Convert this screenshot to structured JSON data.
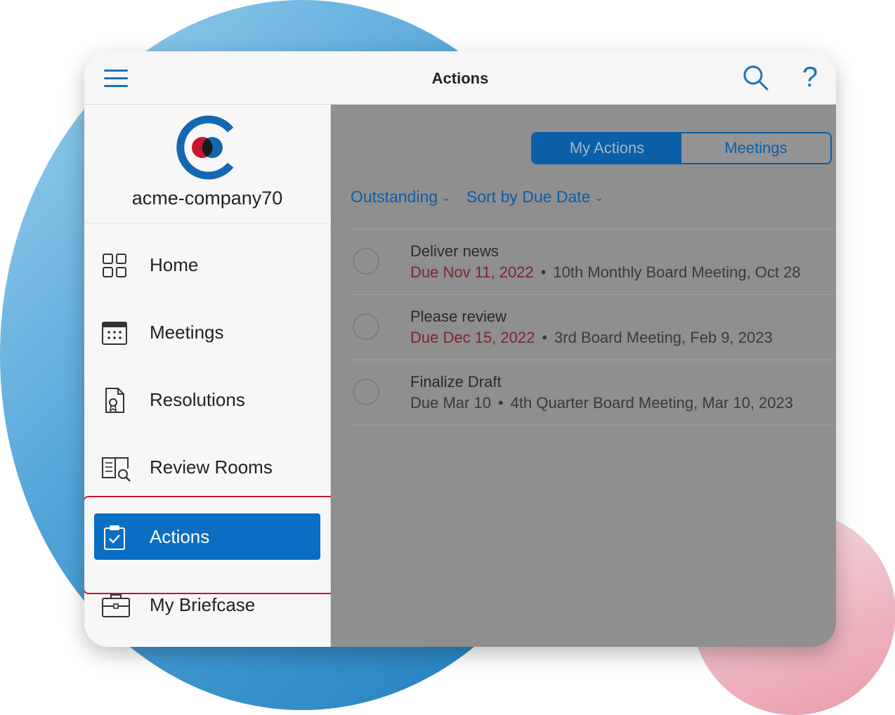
{
  "header": {
    "title": "Actions"
  },
  "sidebar": {
    "company_name": "acme-company70",
    "items": [
      {
        "label": "Home",
        "icon": "grid-icon"
      },
      {
        "label": "Meetings",
        "icon": "calendar-icon"
      },
      {
        "label": "Resolutions",
        "icon": "document-certificate-icon"
      },
      {
        "label": "Review Rooms",
        "icon": "review-book-icon"
      },
      {
        "label": "Actions",
        "icon": "clipboard-check-icon",
        "active": true
      },
      {
        "label": "My Briefcase",
        "icon": "briefcase-icon"
      }
    ]
  },
  "main": {
    "segments": [
      {
        "label": "My Actions",
        "selected": true
      },
      {
        "label": "Meetings",
        "selected": false
      }
    ],
    "filters": {
      "status": "Outstanding",
      "sort": "Sort by Due Date"
    },
    "actions": [
      {
        "title": "Deliver news",
        "due": "Due Nov 11, 2022",
        "meeting": "10th Monthly Board Meeting, Oct 28",
        "overdue": true
      },
      {
        "title": "Please review",
        "due": "Due Dec 15, 2022",
        "meeting": "3rd Board Meeting, Feb 9, 2023",
        "overdue": true
      },
      {
        "title": "Finalize Draft",
        "due": "Due Mar 10",
        "meeting": "4th Quarter Board Meeting, Mar 10, 2023",
        "overdue": false
      }
    ]
  },
  "colors": {
    "accent": "#0a6ec2",
    "overdue": "#7a2530",
    "highlight_border": "#c8142a"
  }
}
